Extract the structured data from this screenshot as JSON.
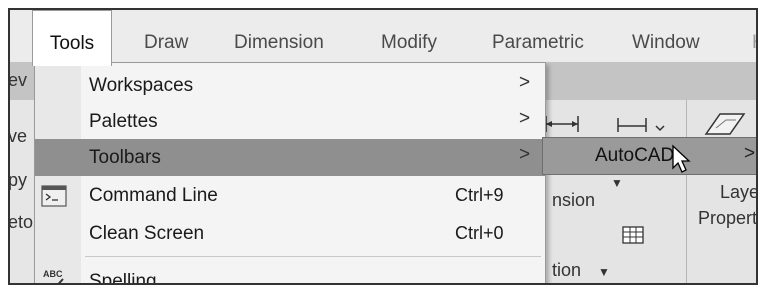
{
  "menubar": {
    "items": [
      {
        "label": "Tools",
        "active": true
      },
      {
        "label": "Draw"
      },
      {
        "label": "Dimension"
      },
      {
        "label": "Modify"
      },
      {
        "label": "Parametric"
      },
      {
        "label": "Window"
      }
    ]
  },
  "background": {
    "left_fragments": [
      "ev",
      "ve",
      "py",
      "eto"
    ],
    "right_fragments": [
      "nsion",
      "tion",
      "Layer",
      "Properti"
    ]
  },
  "dropdown": {
    "items": [
      {
        "label": "Workspaces",
        "shortcut": "",
        "submenu": true
      },
      {
        "label": "Palettes",
        "shortcut": "",
        "submenu": true
      },
      {
        "label": "Toolbars",
        "shortcut": "",
        "submenu": true
      },
      {
        "label": "Command Line",
        "shortcut": "Ctrl+9",
        "icon": "command-line-icon"
      },
      {
        "label": "Clean Screen",
        "shortcut": "Ctrl+0"
      },
      {
        "label": "Spelling",
        "shortcut": "",
        "icon": "spelling-abc-icon"
      }
    ],
    "submenu_arrow": ">"
  },
  "submenu": {
    "label": "AutoCAD",
    "arrow": ">"
  },
  "colors": {
    "highlight": "#8f8f8f",
    "menu_bg": "#f4f4f4",
    "menubar_bg": "#ececec"
  }
}
